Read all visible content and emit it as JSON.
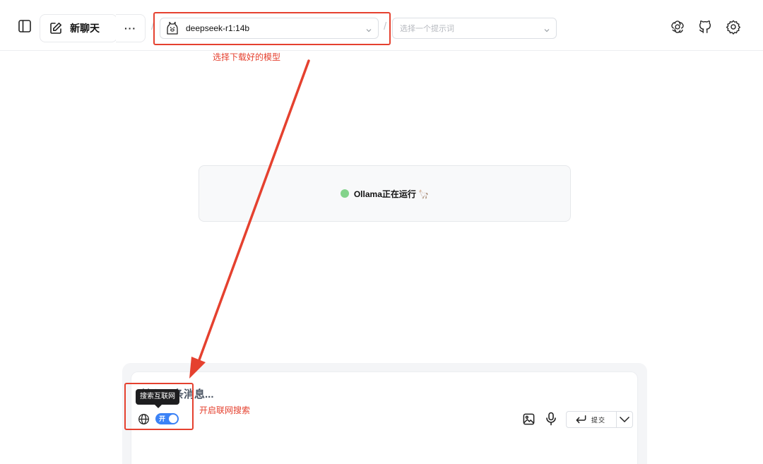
{
  "header": {
    "new_chat_label": "新聊天",
    "more_label": "···",
    "separator": "/",
    "model": {
      "selected": "deepseek-r1:14b"
    },
    "prompt": {
      "placeholder": "选择一个提示词"
    },
    "right_icons": [
      "openai-icon",
      "github-icon",
      "settings-icon"
    ]
  },
  "status": {
    "text": "Ollama正在运行 🦙",
    "dot_color": "#83d38b"
  },
  "composer": {
    "placeholder": "输入一条消息...",
    "tooltip": "搜索互联网",
    "web_search_toggle": {
      "label": "开",
      "on": true
    },
    "submit_label": "提交"
  },
  "annotations": {
    "model_hint": "选择下载好的模型",
    "web_hint": "开启联网搜索",
    "color": "#e5412f"
  }
}
